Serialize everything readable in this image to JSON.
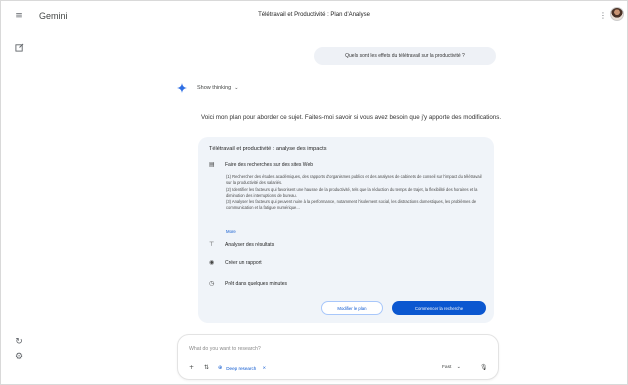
{
  "app": {
    "name": "Gemini",
    "chat_title": "Télétravail et Productivité : Plan d'Analyse"
  },
  "rail": {
    "icons": [
      "menu-icon",
      "new-chat-icon",
      "activity-icon",
      "settings-icon"
    ]
  },
  "user_message": "Quels sont les effets du télétravail sur la productivité ?",
  "response": {
    "show_thinking_label": "Show thinking",
    "intro": "Voici mon plan pour aborder ce sujet. Faites-moi savoir si vous avez besoin que j'y apporte des modifications.",
    "plan": {
      "title": "Télétravail et productivité : analyse des impacts",
      "step1_label": "Faire des recherches sur des sites Web",
      "step1_details": [
        "(1) Rechercher des études académiques, des rapports d'organismes publics et des analyses de cabinets de conseil sur l'impact du télétravail sur la productivité des salariés.",
        "(2) Identifier les facteurs qui favorisent une hausse de la productivité, tels que la réduction du temps de trajet, la flexibilité des horaires et la diminution des interruptions de bureau.",
        "(3) Analyser les facteurs qui peuvent nuire à la performance, notamment l'isolement social, les distractions domestiques, les problèmes de communication et la fatigue numérique..."
      ],
      "more_label": "More",
      "step2_label": "Analyser des résultats",
      "step3_label": "Créer un rapport",
      "step4_label": "Prêt dans quelques minutes",
      "edit_button": "Modifier le plan",
      "start_button": "Commencer la recherche"
    }
  },
  "input": {
    "placeholder": "What do you want to research?",
    "deep_research_label": "Deep research",
    "model_label": "Fast"
  },
  "colors": {
    "accent": "#0b57d0",
    "card_bg": "#f0f4f9",
    "bubble_bg": "#eef1f6"
  }
}
